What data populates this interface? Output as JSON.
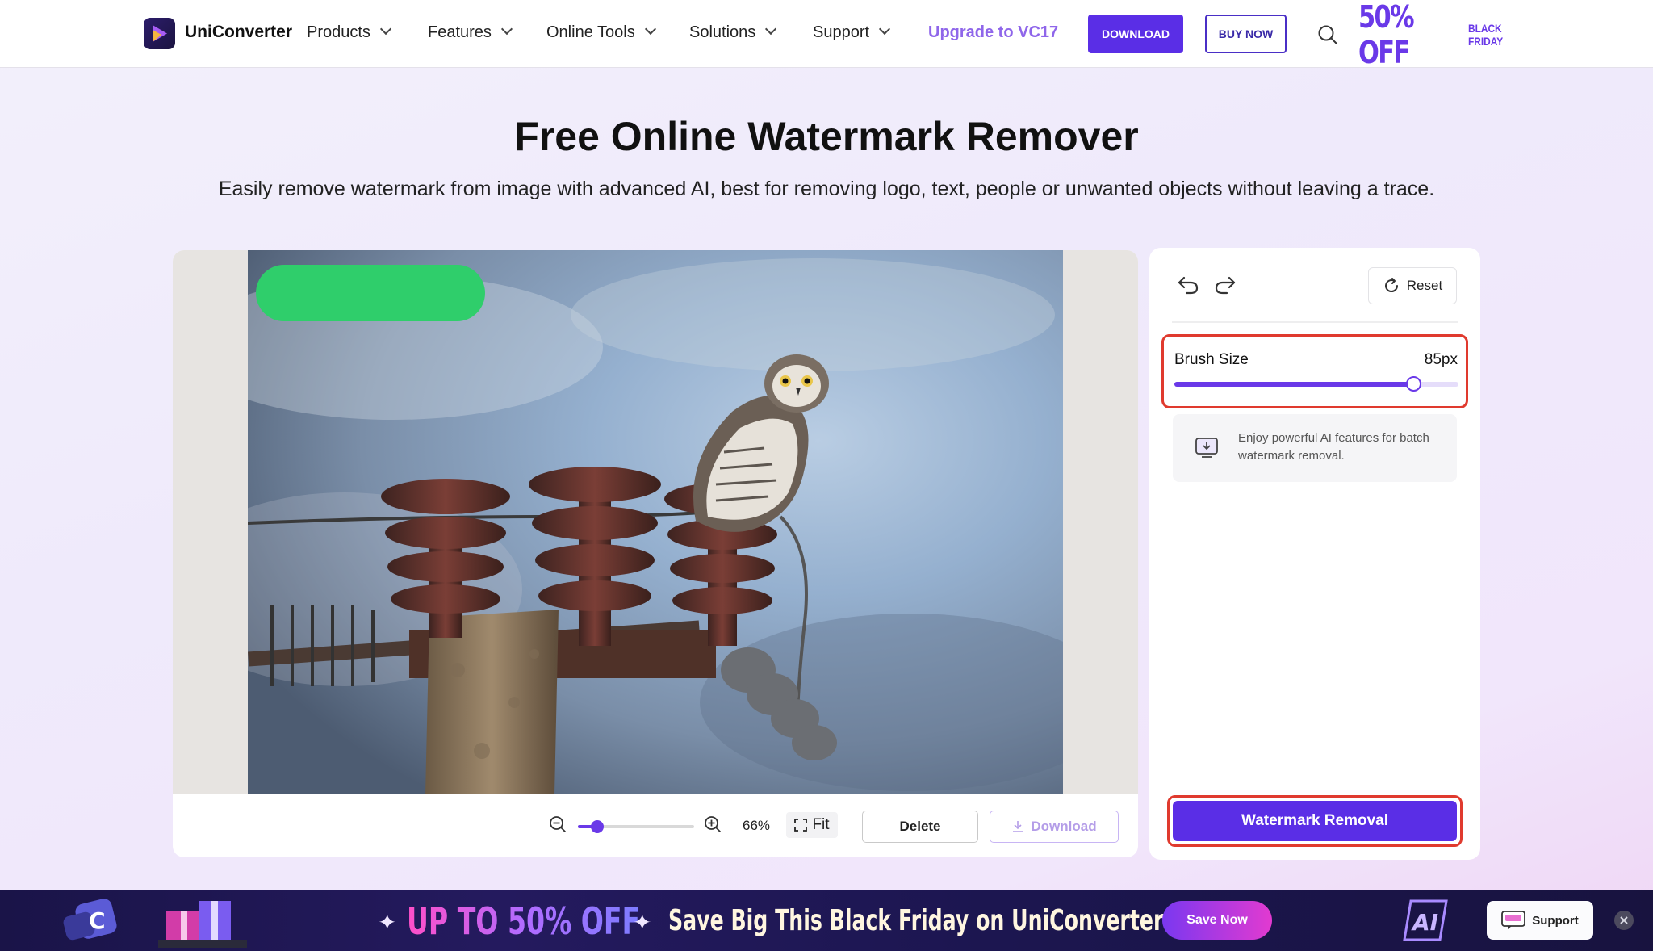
{
  "nav": {
    "brand": "UniConverter",
    "items": [
      {
        "label": "Products"
      },
      {
        "label": "Features"
      },
      {
        "label": "Online Tools"
      },
      {
        "label": "Solutions"
      },
      {
        "label": "Support"
      }
    ],
    "upgrade": "Upgrade to VC17",
    "download": "DOWNLOAD",
    "buy_now": "BUY NOW",
    "promo_big": "50% OFF",
    "promo_small_1": "BLACK",
    "promo_small_2": "FRIDAY"
  },
  "hero": {
    "title": "Free Online Watermark Remover",
    "subtitle": "Easily remove watermark from image with advanced AI, best for removing logo, text, people or unwanted objects without leaving a trace."
  },
  "editor": {
    "zoom_percent_label": "66%",
    "zoom_fraction": 0.17,
    "fit_label": "Fit",
    "delete_label": "Delete",
    "download_label": "Download"
  },
  "panel": {
    "reset_label": "Reset",
    "brush_label": "Brush Size",
    "brush_value": "85px",
    "brush_fraction": 0.84,
    "batch_text": "Enjoy powerful AI features for batch watermark removal.",
    "action_label": "Watermark Removal"
  },
  "banner": {
    "off_text": "UP TO 50% OFF",
    "save_text": "Save Big This Black Friday on UniConverter 17!",
    "save_now": "Save Now",
    "support": "Support"
  },
  "colors": {
    "accent": "#5a2ee6",
    "highlight_outline": "#e03a2e",
    "brush_mark": "#2fce6b"
  }
}
